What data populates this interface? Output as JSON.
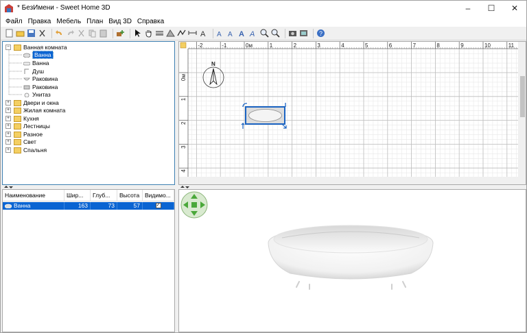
{
  "window": {
    "title": "* БезИмени - Sweet Home 3D",
    "controls": {
      "minimize": "–",
      "maximize": "☐",
      "close": "✕"
    }
  },
  "menu": [
    "Файл",
    "Правка",
    "Мебель",
    "План",
    "Вид 3D",
    "Справка"
  ],
  "toolbar": {
    "icons": [
      "new-file-icon",
      "open-folder-icon",
      "save-icon",
      "cut-scissors-icon",
      "sep",
      "undo-icon",
      "redo-icon",
      "cut-icon",
      "copy-icon",
      "paste-icon",
      "sep",
      "add-furniture-icon",
      "sep",
      "select-arrow-icon",
      "pan-hand-icon",
      "create-walls-icon",
      "create-rooms-icon",
      "create-polylines-icon",
      "create-dimensions-icon",
      "create-labels-icon",
      "sep",
      "text-style-icon-1",
      "text-style-icon-2",
      "text-style-icon-3",
      "text-style-icon-4",
      "zoom-in-icon",
      "zoom-out-icon",
      "sep",
      "create-photo-icon",
      "create-video-icon",
      "sep",
      "help-icon"
    ]
  },
  "catalog": {
    "categories": [
      {
        "label": "Ванная комната",
        "expanded": true,
        "items": [
          "Ванна",
          "Ванна",
          "Душ",
          "Раковина",
          "Раковина",
          "Унитаз"
        ],
        "selected_item": 0
      },
      {
        "label": "Двери и окна",
        "expanded": false
      },
      {
        "label": "Жилая комната",
        "expanded": false
      },
      {
        "label": "Кухня",
        "expanded": false
      },
      {
        "label": "Лестницы",
        "expanded": false
      },
      {
        "label": "Разное",
        "expanded": false
      },
      {
        "label": "Свет",
        "expanded": false
      },
      {
        "label": "Спальня",
        "expanded": false
      }
    ]
  },
  "furniture_table": {
    "columns": [
      "Наименование",
      "Шир...",
      "Глуб...",
      "Высота",
      "Видимо..."
    ],
    "rows": [
      {
        "name": "Ванна",
        "width": "163",
        "depth": "73",
        "height": "57",
        "visible": "✓"
      }
    ]
  },
  "plan": {
    "ruler_x_labels": [
      "-2",
      "-1",
      "0м",
      "1",
      "2",
      "3",
      "4",
      "5",
      "6",
      "7",
      "8",
      "9",
      "10",
      "11"
    ],
    "ruler_y_labels": [
      "0м",
      "1",
      "2",
      "3",
      "4"
    ],
    "compass_label": "N"
  },
  "colors": {
    "selection": "#0a64d2",
    "folder": "#f4cf62",
    "navigation_green": "#4aa83a",
    "plan_grid": "#e6e6e6",
    "plan_grid_major": "#bdbdbd"
  }
}
